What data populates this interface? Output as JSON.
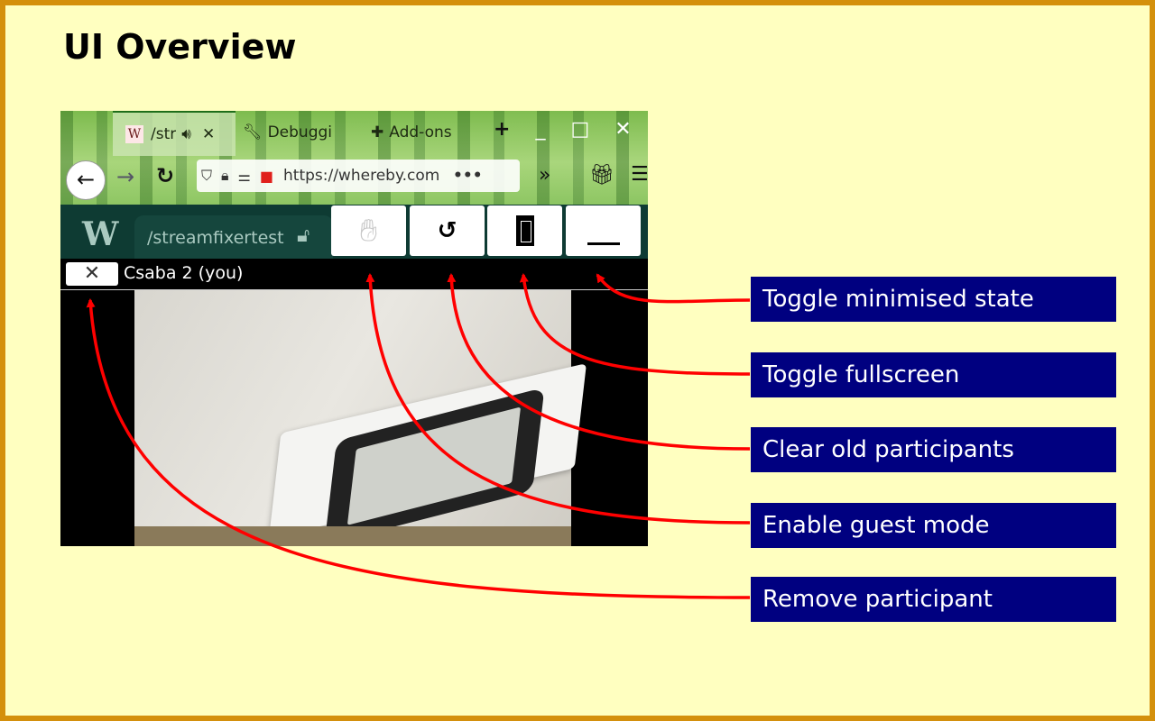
{
  "slide": {
    "title": "UI Overview"
  },
  "browser": {
    "tabs": [
      {
        "favicon": "W",
        "label": "/str",
        "audio_icon": "speaker-icon",
        "close": "✕"
      },
      {
        "icon": "wrench-icon",
        "label": "Debuggi"
      },
      {
        "icon": "puzzle-icon",
        "label": "Add-ons"
      }
    ],
    "new_tab": "+",
    "window_controls": [
      "_",
      "□",
      "✕"
    ],
    "url": "https://whereby.com",
    "url_more": "•••"
  },
  "app": {
    "logo": "W",
    "room_name": "/streamfixertest",
    "participant_name": "Csaba 2 (you)",
    "remove_label": "✕"
  },
  "callouts": [
    {
      "label": "Toggle minimised state",
      "target": "minimise-button"
    },
    {
      "label": "Toggle fullscreen",
      "target": "fullscreen-button"
    },
    {
      "label": "Clear old participants",
      "target": "clear-participants-button"
    },
    {
      "label": "Enable guest mode",
      "target": "guest-mode-button"
    },
    {
      "label": "Remove participant",
      "target": "remove-participant-button"
    }
  ],
  "colors": {
    "background": "#ffffc0",
    "border": "#d4900c",
    "callout": "#000080",
    "arrow": "#ff0000"
  }
}
